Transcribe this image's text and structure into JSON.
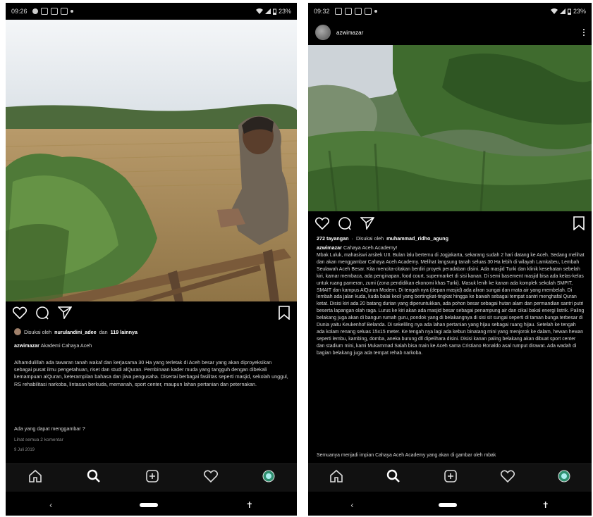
{
  "left": {
    "status": {
      "time": "09:26",
      "battery": "23%"
    },
    "liked_by": {
      "prefix": "Disukai oleh",
      "user": "nurulandini_adee",
      "mid": "dan",
      "count": "119 lainnya"
    },
    "caption": {
      "user": "azwimazar",
      "title": "Akademi Cahaya Aceh"
    },
    "body": "Alhamdulillah ada tawaran tanah wakaf dan kerjasama 30 Ha yang terletak di Aceh besar yang akan diproyeksikan sebagai pusat ilmu pengetahuan, riset dan studi alQuran. Pembinaan kader muda yang tangguh dengan dibekali kemampuan alQuran, keterampilan bahasa dan jiwa pengusaha. Disertai berbagai fasilitas seperti masjid, sekolah unggul, RS rehabilitasi narkoba, lintasan berkuda, memanah, sport center, maupun lahan pertanian dan peternakan.",
    "question": "Ada yang dapat menggambar ?",
    "comments": "Lihat semua 2 komentar",
    "date": "9 Juli 2019"
  },
  "right": {
    "status": {
      "time": "09:32",
      "battery": "23%"
    },
    "header_user": "azwimazar",
    "views": {
      "count": "272 tayangan",
      "prefix": "Disukai oleh",
      "user": "muhammad_ridho_agung"
    },
    "caption": {
      "user": "azwimazar",
      "title": "Cahaya Aceh Academy!"
    },
    "body": "Mbak Luluk, mahasiswi arsitek UII. Bulan lalu bertemu di Jogjakarta, sekarang sudah 2 hari datang ke Aceh. Sedang melihat dan akan menggambar Cahaya Aceh Academy. Melihat langsung tanah seluas 30 Ha lebih di wilayah Lamkabeu, Lembah Seulawah Aceh Besar. Kita mencita-citakan berdiri proyek peradaban disini. Ada masjid Turki dan klinik kesehatan sebelah kiri, kamar membaca, ada penginapan, food court, supermarket di sisi kanan. Di semi basement masjid bisa ada kelas-kelas untuk ruang pameran, zumi (zona pendidikan ekonomi khas Turki). Masuk lenih ke kanan ada komplek sekolah SMPIT, SMAIT dan kampus AlQuran Modern. Di tengah nya (depan masjid) ada aliran sungai dan mata air yang membelah. Di lembah ada jalan kuda, kuda balai kecil yang bertingkat-tingkat hingga ke bawah sebagai tempat santri menghafal Quran ketat. Disisi kiri ada 20 batang durian yang diperuntukkan, ada pohon besar sebagai hutan alam dan permandian santri putri beserta lapangan olah raga. Lurus ke kiri akan ada masjid besar sebagai penampung air dan cikal bakal energi listrik. Paling belakang juga akan di bangun rumah guru, pondok yang di belakangnya di sisi sit sungai seperti di taman bunga terbesar di Dunia yaitu Keukenhof Belanda. Di sekeliling nya ada lahan pertanian yang hijau sebagai ruang hijau. Setelah ke tengah ada kolam renang seluas 15x15 meter. Ke tengah nya lagi ada kebun binatang mini yang menjorok ke dalam, hewan hewan seperti lembu, kambing, domba, aneka burung dll dipelihara disini. Disisi kanan paling belakang akan dibuat sport center dan stadium mini, kami Mukammad Salah bisa main ke Aceh sama Cristiano Ronaldo asal rumput dirawat. Ada wadah di bagian belakang juga ada tempat rehab narkoba.",
    "footer": "Semuanya menjadi impian Cahaya Aceh Academy yang akan di gambar oleh mbak"
  }
}
